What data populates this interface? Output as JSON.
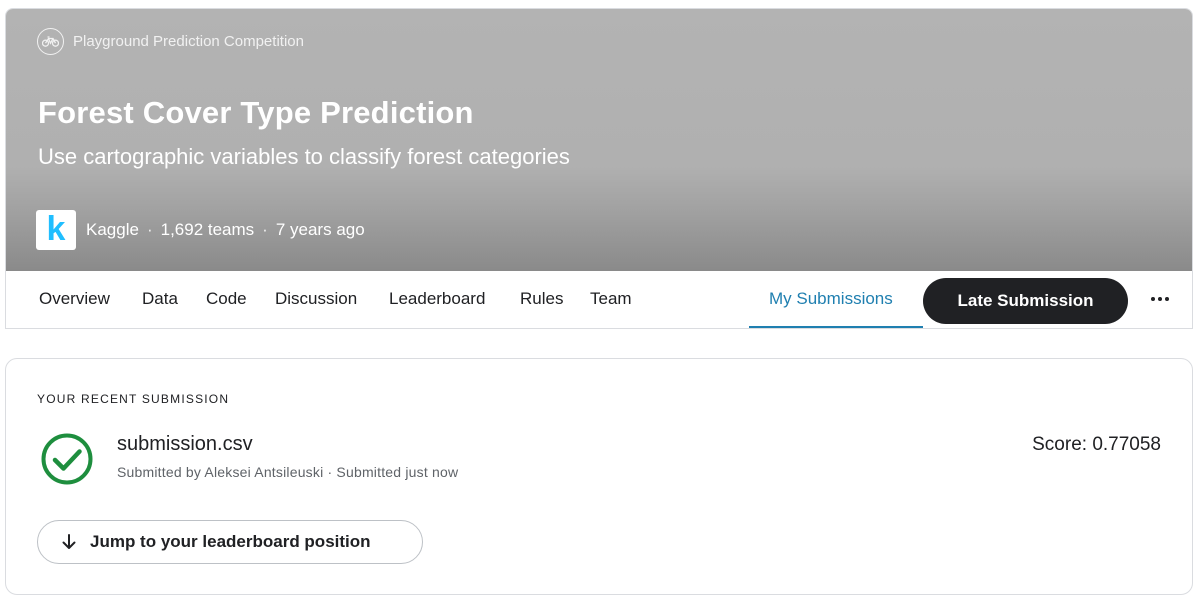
{
  "header": {
    "competition_type": "Playground Prediction Competition",
    "competition_type_icon": "bicycle-icon",
    "title": "Forest Cover Type Prediction",
    "subtitle": "Use cartographic variables to classify forest categories",
    "logo_letter": "k",
    "host": "Kaggle",
    "teams": "1,692 teams",
    "age": "7 years ago",
    "separator": "·"
  },
  "nav": {
    "tabs": [
      {
        "label": "Overview"
      },
      {
        "label": "Data"
      },
      {
        "label": "Code"
      },
      {
        "label": "Discussion"
      },
      {
        "label": "Leaderboard"
      },
      {
        "label": "Rules"
      },
      {
        "label": "Team"
      },
      {
        "label": "My Submissions",
        "active": true
      }
    ],
    "late_submission_label": "Late Submission",
    "more_icon": "more-horizontal-icon"
  },
  "submission": {
    "section_label": "YOUR RECENT SUBMISSION",
    "status_icon": "check-circle-icon",
    "filename": "submission.csv",
    "submitted_text": "Submitted by Aleksei Antsileuski · Submitted just now",
    "score_text": "Score: 0.77058",
    "jump_label": "Jump to your leaderboard position",
    "jump_icon": "arrow-down-icon"
  },
  "colors": {
    "accent_blue": "#1f7fb0",
    "success_green": "#1e8e3e",
    "kaggle_blue": "#20beff",
    "dark_button": "#202124"
  }
}
